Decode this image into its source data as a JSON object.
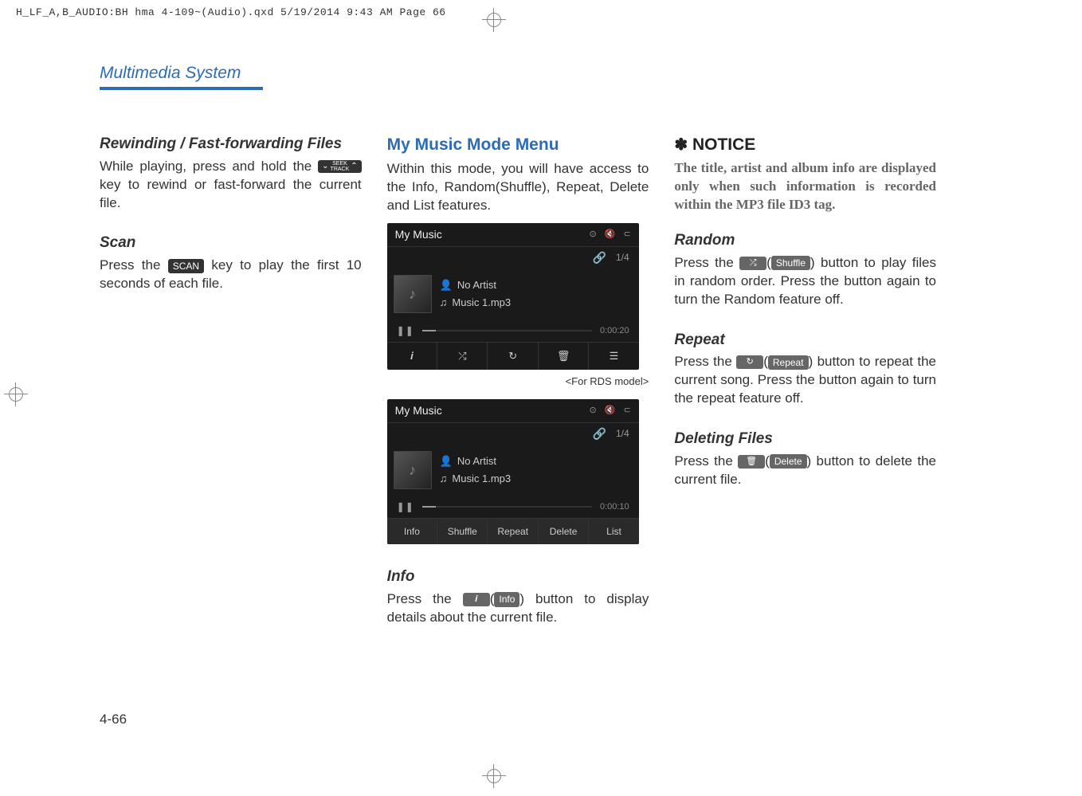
{
  "printInfo": "H_LF_A,B_AUDIO:BH hma 4-109~(Audio).qxd  5/19/2014  9:43 AM  Page 66",
  "sectionTitle": "Multimedia System",
  "col1": {
    "h1": "Rewinding / Fast-forwarding Files",
    "p1a": "While playing, press and hold the ",
    "seekKey": {
      "top": "SEEK",
      "bottom": "TRACK"
    },
    "p1b": " key to rewind or fast-forward the current file.",
    "h2": "Scan",
    "p2a": "Press the ",
    "scanKey": "SCAN",
    "p2b": " key to play the first 10 seconds of each file."
  },
  "col2": {
    "h1": "My Music Mode Menu",
    "p1": "Within this mode, you will have access to the Info, Random(Shuffle), Repeat, Delete and List features.",
    "screenshot1": {
      "title": "My Music",
      "track_count": "1/4",
      "artist": "No Artist",
      "filename": "Music 1.mp3",
      "time": "0:00:20",
      "btns": {
        "info": "𝒊",
        "shuffle": "⤮",
        "repeat": "↻",
        "delete": "🗑",
        "list": "☰"
      }
    },
    "caption1": "<For RDS model>",
    "screenshot2": {
      "title": "My Music",
      "track_count": "1/4",
      "artist": "No Artist",
      "filename": "Music 1.mp3",
      "time": "0:00:10",
      "btns": {
        "info": "Info",
        "shuffle": "Shuffle",
        "repeat": "Repeat",
        "delete": "Delete",
        "list": "List"
      }
    },
    "h2": "Info",
    "p2a": "Press the ",
    "infoIcon": "𝒊",
    "infoLabel": "Info",
    "p2b": ") button to display details about the current file."
  },
  "col3": {
    "noticeSymbol": "✽",
    "noticeHeading": "NOTICE",
    "noticeText": "The title, artist and album info are displayed only when such information is recorded within the MP3 file ID3 tag.",
    "h1": "Random",
    "p1a": "Press the ",
    "shuffleIcon": "⤮",
    "shuffleLabel": "Shuffle",
    "p1b": ") button to play files in random order. Press the button again to turn the Random feature off.",
    "h2": "Repeat",
    "p2a": "Press the ",
    "repeatIcon": "↻",
    "repeatLabel": "Repeat",
    "p2b": ") button to repeat the current song. Press the button again to turn the repeat feature off.",
    "h3": "Deleting Files",
    "p3a": "Press the ",
    "deleteIcon": "🗑",
    "deleteLabel": "Delete",
    "p3b": ") button to delete the current file."
  },
  "pageNumber": "4-66"
}
